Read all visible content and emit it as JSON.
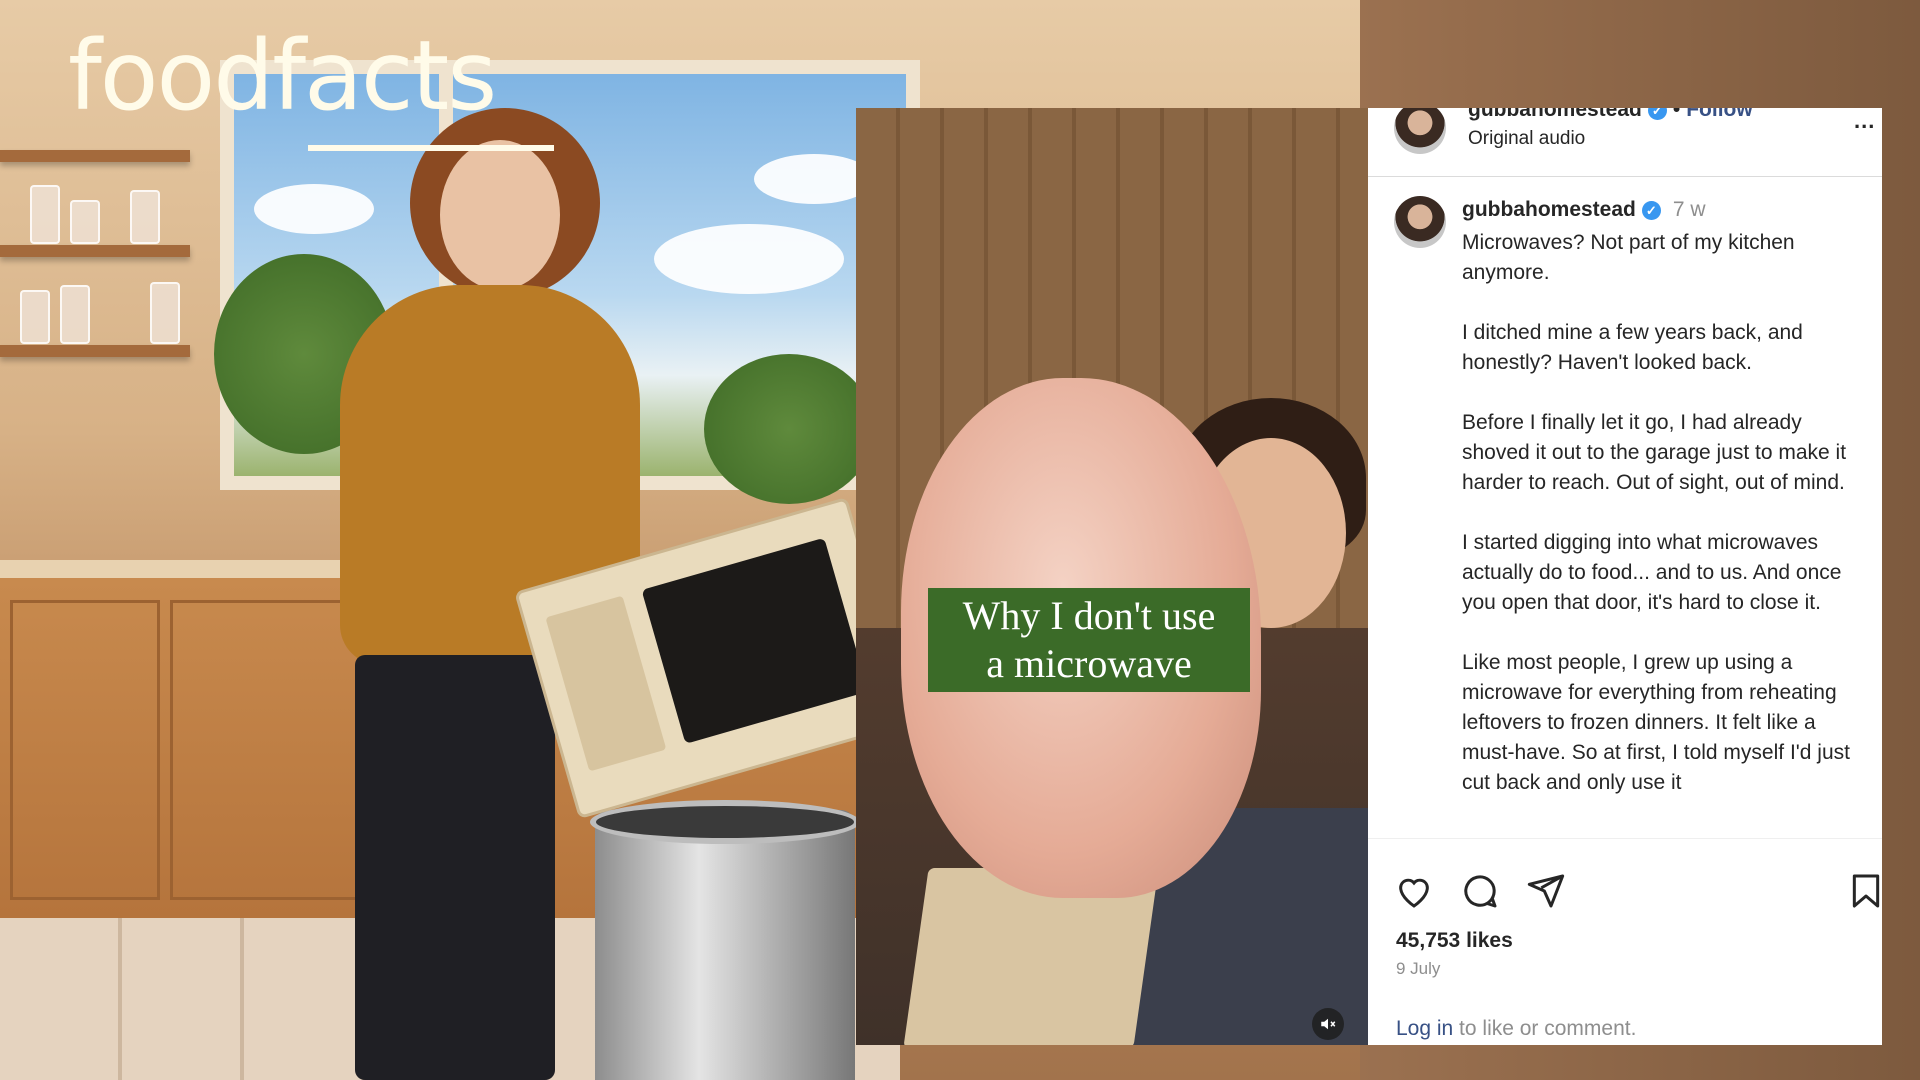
{
  "brand": {
    "logo_text": "foodfacts"
  },
  "video": {
    "caption_line1": "Why I don't use",
    "caption_line2": "a microwave",
    "mute_icon": "mute-icon"
  },
  "instagram": {
    "header": {
      "username": "gubbahomestead",
      "follow_label": "Follow",
      "dot": "•",
      "audio_label": "Original audio",
      "more_label": "..."
    },
    "post": {
      "username": "gubbahomestead",
      "time": "7 w",
      "paragraphs": [
        "Microwaves? Not part of my kitchen anymore.",
        "I ditched mine a few years back, and honestly? Haven't looked back.",
        "Before I finally let it go, I had already shoved it out to the garage just to make it harder to reach. Out of sight, out of mind.",
        "I started digging into what microwaves actually do to food... and to us. And once you open that door, it's hard to close it.",
        "Like most people, I grew up using a microwave for everything from reheating leftovers to frozen dinners. It felt like a must-have. So at first, I told myself I'd just cut back and only use it"
      ]
    },
    "actions": {
      "likes": "45,753 likes",
      "date": "9 July",
      "login_link": "Log in",
      "login_rest": " to like or comment."
    },
    "colors": {
      "link": "#385185",
      "verified": "#3897f0",
      "muted": "#8e8e8e"
    }
  }
}
